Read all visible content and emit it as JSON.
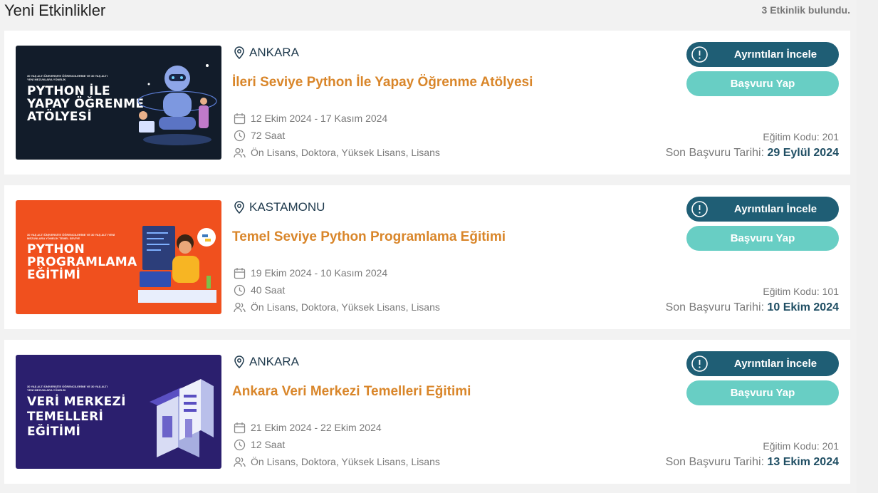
{
  "header": {
    "title": "Yeni Etkinlikler",
    "count": "3 Etkinlik bulundu."
  },
  "events": [
    {
      "location": "ANKARA",
      "title": "İleri Seviye Python İle Yapay Öğrenme Atölyesi",
      "dates": "12 Ekim 2024 - 17 Kasım 2024",
      "duration": "72 Saat",
      "audience": "Ön Lisans, Doktora, Yüksek Lisans, Lisans",
      "details_label": "Ayrıntıları İncele",
      "apply_label": "Başvuru Yap",
      "code": "Eğitim Kodu: 201",
      "deadline_label": "Son Başvuru Tarihi:",
      "deadline_date": "29 Eylül 2024",
      "banner": {
        "small_text": "30 YAŞ ALTI ÜNİVERSİTE ÖĞRENCİLERİNE VE 30 YAŞ ALTI YENİ MEZUNLARA YÖNELİK",
        "line1": "PYTHON İLE",
        "line2": "YAPAY ÖĞRENME",
        "line3": "ATÖLYESİ",
        "background": "#121c2a"
      }
    },
    {
      "location": "KASTAMONU",
      "title": "Temel Seviye Python Programlama Eğitimi",
      "dates": "19 Ekim 2024 - 10 Kasım 2024",
      "duration": "40 Saat",
      "audience": "Ön Lisans, Doktora, Yüksek Lisans, Lisans",
      "details_label": "Ayrıntıları İncele",
      "apply_label": "Başvuru Yap",
      "code": "Eğitim Kodu: 101",
      "deadline_label": "Son Başvuru Tarihi:",
      "deadline_date": "10 Ekim 2024",
      "banner": {
        "small_text": "30 YAŞ ALTI ÜNİVERSİTE ÖĞRENCİLERİNE VE 30 YAŞ ALTI YENİ MEZUNLARA YÖNELİK TEMEL SEVİYE",
        "line1": "PYTHON",
        "line2": "PROGRAMLAMA",
        "line3": "EĞİTİMİ",
        "background": "#f0501e"
      }
    },
    {
      "location": "ANKARA",
      "title": "Ankara Veri Merkezi Temelleri Eğitimi",
      "dates": "21 Ekim 2024 - 22 Ekim 2024",
      "duration": "12 Saat",
      "audience": "Ön Lisans, Doktora, Yüksek Lisans, Lisans",
      "details_label": "Ayrıntıları İncele",
      "apply_label": "Başvuru Yap",
      "code": "Eğitim Kodu: 201",
      "deadline_label": "Son Başvuru Tarihi:",
      "deadline_date": "13 Ekim 2024",
      "banner": {
        "small_text": "30 YAŞ ALTI ÜNİVERSİTE ÖĞRENCİLERİNE VE 30 YAŞ ALTI YENİ MEZUNLARA YÖNELİK",
        "line1": "VERİ MERKEZİ",
        "line2": "TEMELLERİ",
        "line3": "EĞİTİMİ",
        "background": "#2b1f6e"
      }
    }
  ],
  "colors": {
    "accent_title": "#d9862a",
    "details_button": "#1f5e75",
    "apply_button": "#68cec4",
    "deadline_date": "#1f4e63"
  },
  "icons": {
    "location": "map-pin-icon",
    "date": "calendar-icon",
    "duration": "clock-icon",
    "audience": "users-icon",
    "details": "info-circle-icon"
  }
}
